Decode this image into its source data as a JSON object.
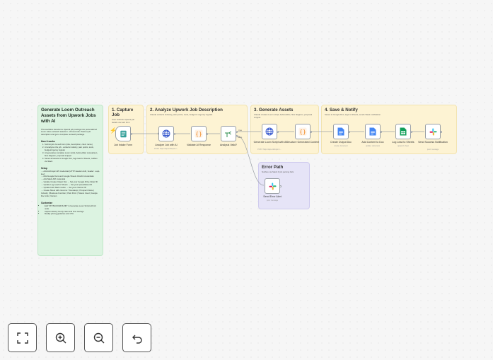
{
  "overview": {
    "title": "Generate Loom Outreach Assets from Upwork Jobs with AI",
    "intro": "This workflow transforms Upwork job postings into personalized Loom video outreach assets in ~60 seconds. Paste a job description and get a complete outreach package.",
    "how_title": "How it works",
    "how_steps": [
      "Submit job via web form (title, description, client name)",
      "AI analyzes the job - extracts industry, pain points, tools, budget/urgency signals",
      "AI generates complete Loom script, before/after comparison, flow diagram, proposal snippet",
      "Saves all assets to Google Doc, logs lead to Sheets, notifies via Slack"
    ],
    "setup_title": "Setup",
    "setup_lines": [
      "→ Add Anthropic API credential (HTTP Header Auth, header: x-api-key)",
      "→ Add Google Docs and Google Sheets OAuth2 credentials",
      "→ Add Slack API credential",
      "→ Update Create Output Doc → Set your Google Drive folder ID",
      "→ Update Log Lead to Sheets → Set your spreadsheet ID",
      "→ Update both Slack nodes → Set your channel ID",
      "→ Create Sheet with columns: Timestamp | Prospect Name | Industry | Business Function | Pain Point | Tokens Used | Google Doc Link | Version"
    ],
    "customize_title": "Customize",
    "customize_lines": [
      "Edit \"MY BACKGROUND\" in Generate Loom Script with AI node",
      "Adjust industry hourly rates and time savings",
      "Modify pricing guidance and CTA"
    ]
  },
  "sections": {
    "capture": {
      "title": "1. Capture Job",
      "desc": "User submits Upwork job details via web form"
    },
    "analyze": {
      "title": "2. Analyze Upwork Job Description",
      "desc": "Claude extracts industry, pain points, tools, budget & urgency signals"
    },
    "generate": {
      "title": "3. Generate Assets",
      "desc": "Claude creates Loom script, before/after, flow diagram, proposal snippet"
    },
    "save": {
      "title": "4. Save & Notify",
      "desc": "Saves to Google Doc, logs to Sheets, sends Slack notification"
    },
    "error": {
      "title": "Error Path",
      "desc": "Notifies via Slack if job parsing fails"
    }
  },
  "nodes": {
    "job_intake": {
      "label": "Job Intake Form",
      "sub": ""
    },
    "analyze_ai": {
      "label": "Analyze Job with AI",
      "sub": "POST: https://api.anthropic.c..."
    },
    "validate": {
      "label": "Validate AI Response",
      "sub": ""
    },
    "valid_check": {
      "label": "Analysis Valid?",
      "sub": ""
    },
    "generate_script": {
      "label": "Generate Loom Script with AI",
      "sub": "POST: https://api.anthropic.c..."
    },
    "structure": {
      "label": "Structure Generated Content",
      "sub": ""
    },
    "create_doc": {
      "label": "Create Output Doc",
      "sub": "create: document"
    },
    "add_content": {
      "label": "Add Content to Doc",
      "sub": "update: document"
    },
    "log_lead": {
      "label": "Log Lead to Sheets",
      "sub": "append: sheet"
    },
    "send_success": {
      "label": "Send Success Notification",
      "sub": "post: message"
    },
    "send_error": {
      "label": "Send Error Alert",
      "sub": "post: message"
    }
  },
  "edges": {
    "true_label": "true",
    "false_label": "false"
  },
  "controls": {
    "fit": "fit-view-icon",
    "zoom_in": "zoom-in-icon",
    "zoom_out": "zoom-out-icon",
    "undo": "undo-icon"
  },
  "colors": {
    "yellow_note": "#fdf3d3",
    "green_note": "#dcf3e1",
    "purple_note": "#e6e4f7",
    "edge": "#9aa0a6",
    "trigger_orange": "#ff6d5a"
  }
}
